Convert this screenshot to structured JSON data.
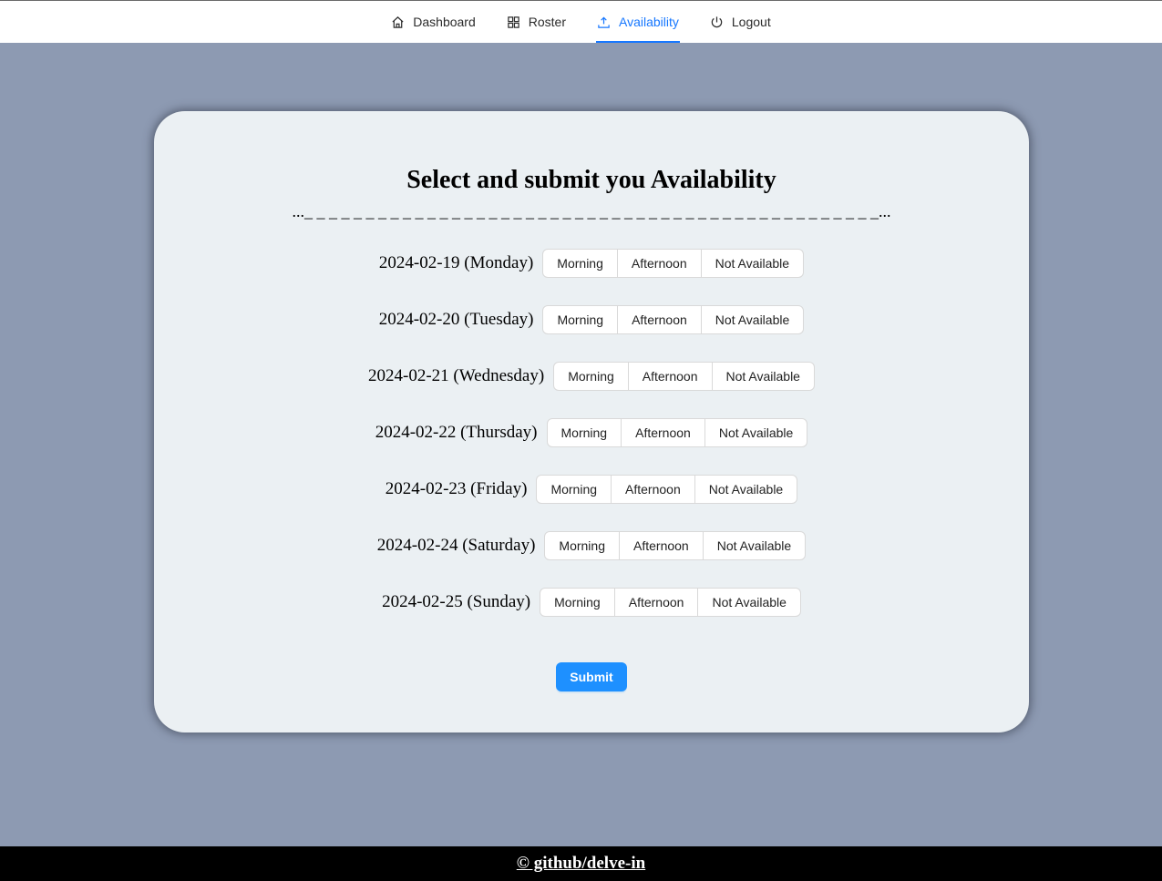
{
  "nav": {
    "items": [
      {
        "label": "Dashboard",
        "icon": "home-icon"
      },
      {
        "label": "Roster",
        "icon": "grid-icon"
      },
      {
        "label": "Availability",
        "icon": "upload-icon",
        "active": true
      },
      {
        "label": "Logout",
        "icon": "power-icon"
      }
    ],
    "accent_color": "#1677ff"
  },
  "main": {
    "title": "Select and submit you Availability",
    "divider": "..._ _ _ _ _ _ _ _ _ _ _ _ _ _ _ _ _ _ _ _ _ _ _ _ _ _ _ _ _ _ _ _ _ _ _ _ _ _ _ _ _ _ _ _ _ _ _...",
    "options": [
      "Morning",
      "Afternoon",
      "Not Available"
    ],
    "days": [
      {
        "date": "2024-02-19 (Monday)"
      },
      {
        "date": "2024-02-20 (Tuesday)"
      },
      {
        "date": "2024-02-21 (Wednesday)"
      },
      {
        "date": "2024-02-22 (Thursday)"
      },
      {
        "date": "2024-02-23 (Friday)"
      },
      {
        "date": "2024-02-24 (Saturday)"
      },
      {
        "date": "2024-02-25 (Sunday)"
      }
    ],
    "submit_label": "Submit",
    "submit_color": "#1e90ff"
  },
  "footer": {
    "text": "© github/delve-in"
  }
}
